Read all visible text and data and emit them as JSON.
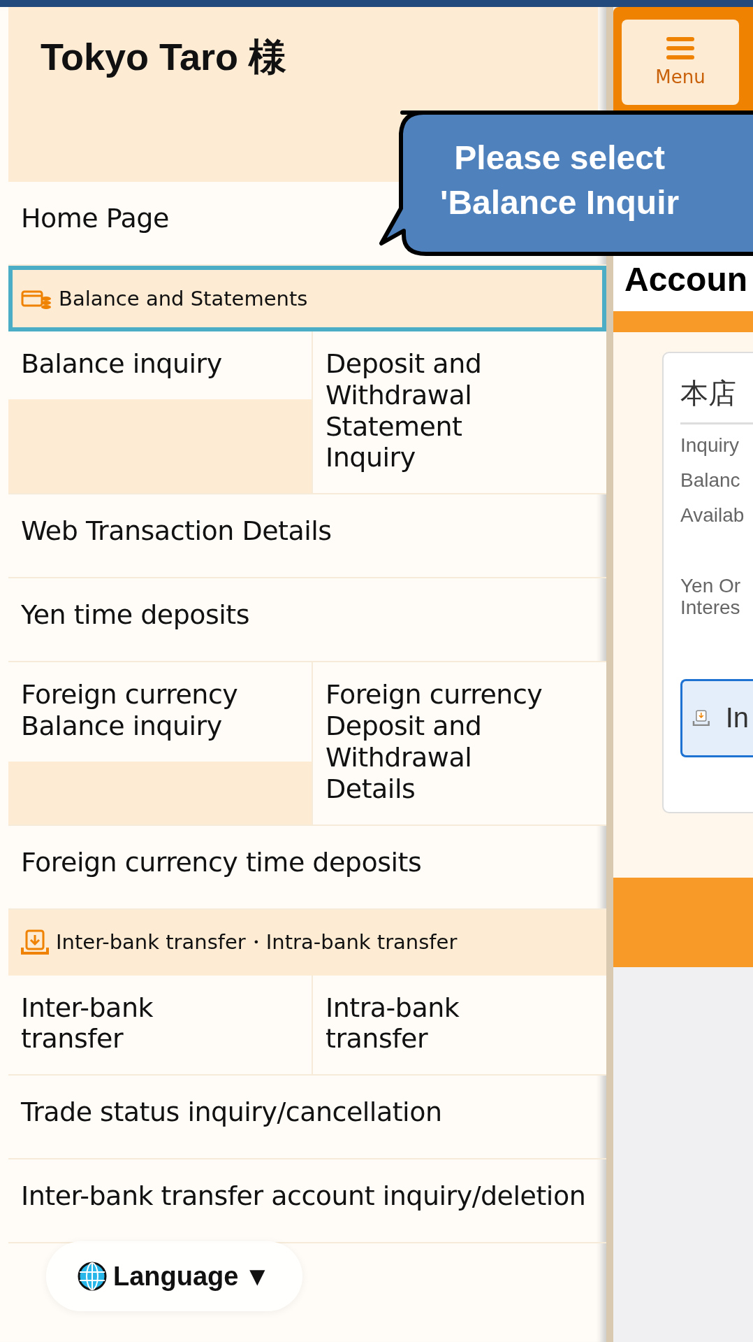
{
  "drawer": {
    "user_name": "Tokyo Taro",
    "honorific": "様",
    "menu": [
      {
        "kind": "link",
        "label": "Home Page"
      },
      {
        "kind": "section",
        "label": "Balance and Statements",
        "selected": true
      },
      {
        "kind": "pair",
        "items": [
          "Balance inquiry",
          "Deposit and Withdrawal Statement Inquiry"
        ]
      },
      {
        "kind": "link",
        "label": "Web Transaction Details"
      },
      {
        "kind": "link",
        "label": "Yen time deposits"
      },
      {
        "kind": "pair",
        "items": [
          "Foreign currency Balance inquiry",
          "Foreign currency Deposit and Withdrawal Details"
        ]
      },
      {
        "kind": "link",
        "label": "Foreign currency time deposits"
      },
      {
        "kind": "section",
        "label": "Inter-bank transfer・Intra-bank transfer",
        "selected": false
      },
      {
        "kind": "pair",
        "items": [
          "Inter-bank transfer",
          "Intra-bank transfer"
        ]
      },
      {
        "kind": "link",
        "label": "Trade status inquiry/cancellation"
      },
      {
        "kind": "link",
        "label": "Inter-bank transfer account inquiry/deletion"
      }
    ]
  },
  "language_button": {
    "label": "Language",
    "caret": "▼"
  },
  "page": {
    "menu_button": "Menu",
    "heading": "Accoun",
    "card": {
      "title": "本店",
      "rows": [
        "Inquiry",
        "Balanc",
        "Availab"
      ],
      "note": [
        "Yen Or",
        "Interes"
      ],
      "button": "In"
    }
  },
  "callout": {
    "lines": [
      "Please select",
      "'Balance Inquir"
    ]
  }
}
